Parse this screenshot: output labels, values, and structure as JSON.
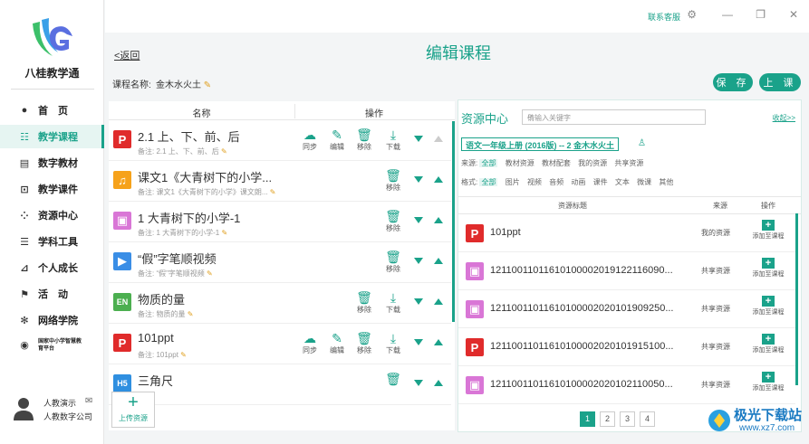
{
  "app": {
    "brand": "八桂教学通",
    "contact": "联系客服"
  },
  "colors": {
    "accent": "#1aa28a",
    "ppt": "#e02b2b",
    "audio": "#f6a21b",
    "image": "#d976d6",
    "video": "#3a8ee6",
    "en": "#4caf50",
    "h5": "#2f8fe0"
  },
  "sidebar": {
    "items": [
      {
        "label": "首　页",
        "icon": "person-icon"
      },
      {
        "label": "教学课程",
        "icon": "course-icon"
      },
      {
        "label": "数字教材",
        "icon": "book-icon"
      },
      {
        "label": "教学课件",
        "icon": "courseware-icon"
      },
      {
        "label": "资源中心",
        "icon": "grid-icon"
      },
      {
        "label": "学科工具",
        "icon": "tools-icon"
      },
      {
        "label": "个人成长",
        "icon": "chart-icon"
      },
      {
        "label": "活　动",
        "icon": "flag-icon"
      },
      {
        "label": "网络学院",
        "icon": "gear-icon"
      },
      {
        "label": "国家中小学智慧教育平台",
        "icon": "platform-icon"
      }
    ],
    "user": {
      "name": "人教演示",
      "org": "人教数字公司"
    }
  },
  "header": {
    "back": "<返回",
    "title": "编辑课程",
    "course_label": "课程名称:",
    "course_name": "金木水火土",
    "save": "保 存",
    "teach": "上 课"
  },
  "lessons": {
    "col_name": "名称",
    "col_ops": "操作",
    "ops": {
      "sync": "同步",
      "edit": "编辑",
      "remove": "移除",
      "download": "下载"
    },
    "rows": [
      {
        "badge": "P",
        "title": "2.1 上、下、前、后",
        "note": "备注: 2.1 上、下、前、后"
      },
      {
        "badge": "♫",
        "title": "课文1《大青树下的小学...",
        "note": "备注: 课文1《大青树下的小学》课文朗..."
      },
      {
        "badge": "▣",
        "title": "1 大青树下的小学-1",
        "note": "备注: 1 大青树下的小学-1"
      },
      {
        "badge": "▶",
        "title": "“假”字笔顺视频",
        "note": "备注: “假”字笔顺视频"
      },
      {
        "badge": "EN",
        "title": "物质的量",
        "note": "备注: 物质的量"
      },
      {
        "badge": "P",
        "title": "101ppt",
        "note": "备注: 101ppt"
      },
      {
        "badge": "H5",
        "title": "三角尺",
        "note": ""
      }
    ],
    "upload": "上传资源"
  },
  "resources": {
    "title": "资源中心",
    "search_placeholder": "请输入关键字",
    "collapse": "收起>>",
    "book": "语文一年级上册 (2016版) -- 2 金木水火土",
    "source_label": "来源:",
    "source_options": [
      "全部",
      "教材资源",
      "教材配套",
      "我的资源",
      "共享资源"
    ],
    "format_label": "格式:",
    "format_options": [
      "全部",
      "图片",
      "视频",
      "音频",
      "动画",
      "课件",
      "文本",
      "微课",
      "其他"
    ],
    "col_title": "资源标题",
    "col_source": "来源",
    "col_ops": "操作",
    "add_label": "添加至课程",
    "rows": [
      {
        "badge": "P",
        "title": "101ppt",
        "source": "我的资源"
      },
      {
        "badge": "▣",
        "title": "12110011011610100002019122116090...",
        "source": "共享资源"
      },
      {
        "badge": "▣",
        "title": "12110011011610100002020101909250...",
        "source": "共享资源"
      },
      {
        "badge": "P",
        "title": "12110011011610100002020101915100...",
        "source": "共享资源"
      },
      {
        "badge": "▣",
        "title": "12110011011610100002020102110050...",
        "source": "共享资源"
      }
    ],
    "pages": [
      "1",
      "2",
      "3",
      "4"
    ]
  },
  "watermark": {
    "line1": "极光下载站",
    "line2": "www.xz7.com"
  }
}
